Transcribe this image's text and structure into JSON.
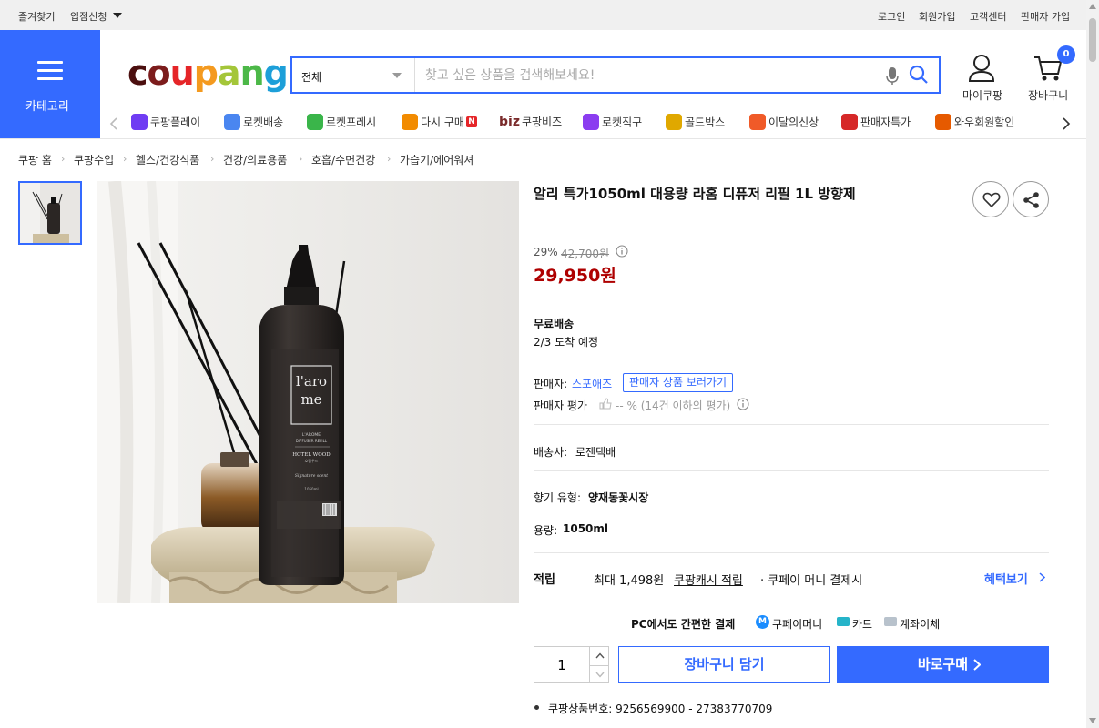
{
  "topbar": {
    "favorites": "즐겨찾기",
    "seller_apply": "입점신청",
    "login": "로그인",
    "signup": "회원가입",
    "support": "고객센터",
    "seller_signup": "판매자 가입"
  },
  "header": {
    "category_label": "카테고리",
    "logo_text": [
      "c",
      "o",
      "u",
      "p",
      "a",
      "n",
      "g"
    ],
    "logo_colors": [
      "#4b0f0f",
      "#7c1c1c",
      "#e52528",
      "#f49a1f",
      "#a4c639",
      "#4cb848",
      "#1d9fd9"
    ],
    "search_scope": "전체",
    "search_placeholder": "찾고 싶은 상품을 검색해보세요!",
    "mycoupang": "마이쿠팡",
    "cart": "장바구니",
    "cart_count": "0"
  },
  "nav": {
    "items": [
      {
        "label": "쿠팡플레이",
        "icon": "play-icon"
      },
      {
        "label": "로켓배송",
        "icon": "rocket-icon"
      },
      {
        "label": "로켓프레시",
        "icon": "rocket-fresh-icon"
      },
      {
        "label": "다시 구매",
        "icon": "basket-icon"
      },
      {
        "label": "쿠팡비즈",
        "icon": "biz-icon",
        "prefix": "biz"
      },
      {
        "label": "로켓직구",
        "icon": "rocket-global-icon"
      },
      {
        "label": "골드박스",
        "icon": "goldbox-icon"
      },
      {
        "label": "이달의신상",
        "icon": "new-icon"
      },
      {
        "label": "판매자특가",
        "icon": "percent-icon"
      },
      {
        "label": "와우회원할인",
        "icon": "wow-icon"
      }
    ],
    "new_badge": "N"
  },
  "breadcrumb": [
    "쿠팡 홈",
    "쿠팡수입",
    "헬스/건강식품",
    "건강/의료용품",
    "호흡/수면건강",
    "가습기/에어워셔"
  ],
  "product": {
    "title": "알리 특가1050ml 대용량 라홈 디퓨저 리필 1L 방향제",
    "discount_rate": "29%",
    "original_price": "42,700원",
    "sale_price": "29,950원",
    "shipping_title": "무료배송",
    "arrival": "2/3 도착 예정",
    "seller_label": "판매자:",
    "seller_name": "스포애즈",
    "seller_link": "판매자 상품 보러가기",
    "seller_rating_label": "판매자 평가",
    "seller_rating_value": "-- % (14건 이하의 평가)",
    "courier_label": "배송사:",
    "courier": "로젠택배",
    "scent_label": "향기 유형:",
    "scent": "양재동꽃시장",
    "volume_label": "용량:",
    "volume": "1050ml",
    "reward_label": "적립",
    "reward_text": "최대 1,498원",
    "reward_link": "쿠팡캐시 적립",
    "reward_suffix": "· 쿠페이 머니 결제시",
    "benefit_link": "혜택보기",
    "pay_title": "PC에서도 간편한 결제",
    "pay_methods": [
      "쿠페이머니",
      "카드",
      "계좌이체"
    ],
    "quantity": "1",
    "add_to_cart": "장바구니 담기",
    "buy_now": "바로구매",
    "product_no": "쿠팡상품번호: 9256569900 - 27383770709"
  },
  "image_label": {
    "brand": "l'aro me",
    "sub": "L'AROME DIFFUSER REFILL",
    "scent": "HOTEL WOOD",
    "volume": "1050ml"
  }
}
